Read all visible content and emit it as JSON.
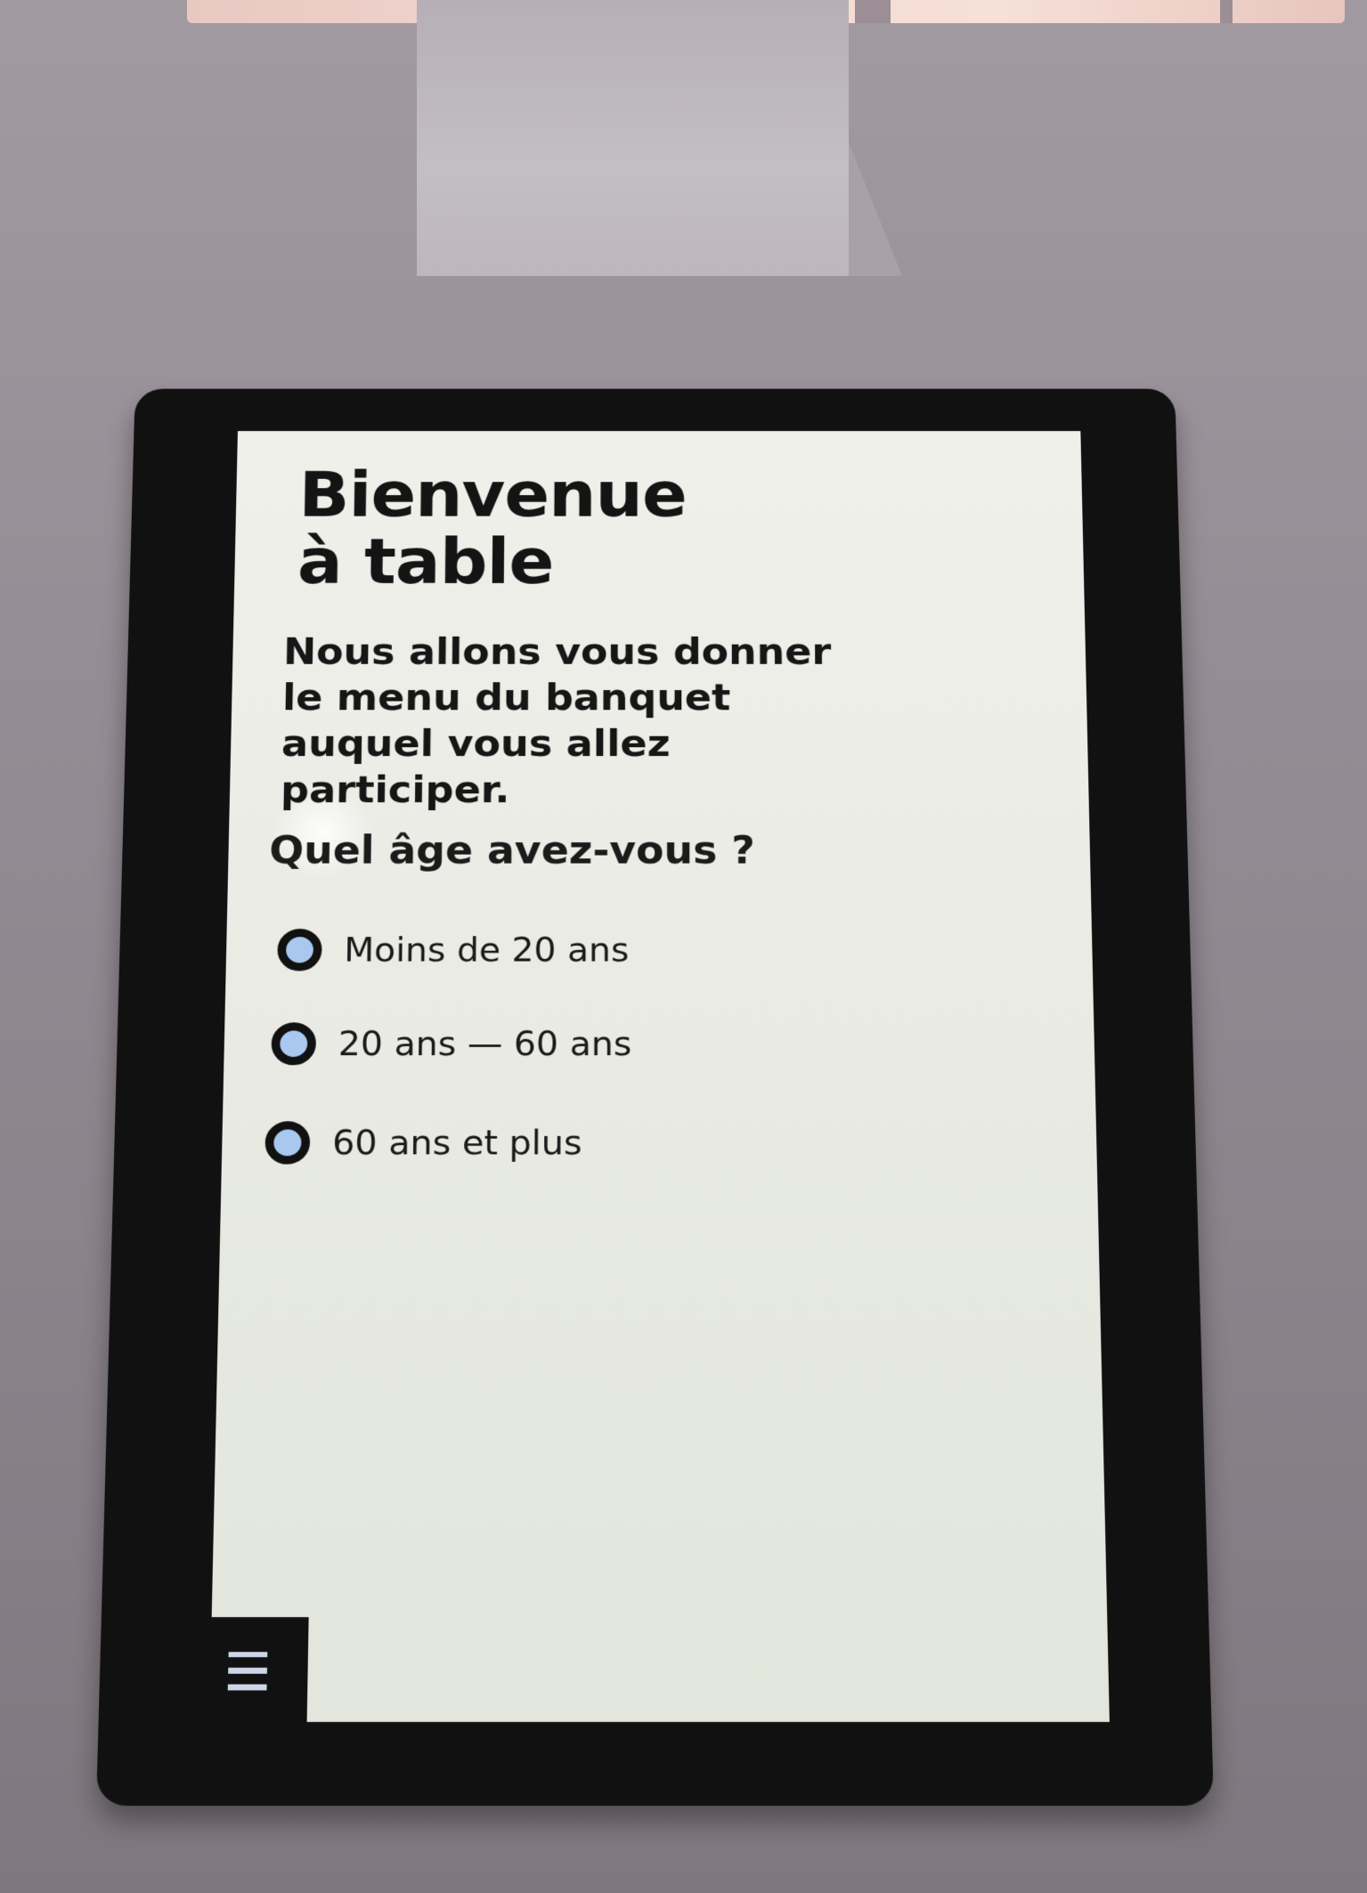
{
  "screen": {
    "title": "Bienvenue\nà table",
    "intro": "Nous allons vous donner\nle menu du banquet\nauquel vous allez\nparticiper.",
    "question": "Quel âge avez-vous ?",
    "options": [
      {
        "label": "Moins de 20 ans",
        "selected": false
      },
      {
        "label": "20 ans — 60 ans",
        "selected": false
      },
      {
        "label": "60 ans et plus",
        "selected": false
      }
    ],
    "menu_icon": "hamburger-menu-icon"
  },
  "colors": {
    "radio_fill": "#a9c8f0",
    "radio_border": "#111111",
    "text": "#141414",
    "screen_bg": "#eff0ea",
    "bezel": "#111112"
  }
}
